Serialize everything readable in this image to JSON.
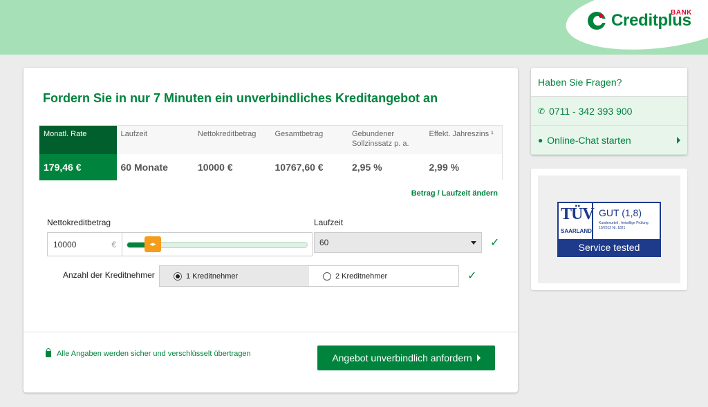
{
  "brand": {
    "name": "Creditplus",
    "tag": "BANK"
  },
  "headline": "Fordern Sie in nur 7 Minuten ein unverbindliches Kreditangebot an",
  "rate_table": [
    {
      "header": "Monatl. Rate",
      "value": "179,46 €"
    },
    {
      "header": "Laufzeit",
      "value": "60 Monate"
    },
    {
      "header": "Nettokreditbetrag",
      "value": "10000 €"
    },
    {
      "header": "Gesamtbetrag",
      "value": "10767,60 €"
    },
    {
      "header": "Gebundener Sollzinssatz p. a.",
      "value": "2,95 %"
    },
    {
      "header": "Effekt. Jahreszins ¹",
      "value": "2,99 %"
    }
  ],
  "change_link": "Betrag / Laufzeit ändern",
  "amount": {
    "label": "Nettokreditbetrag",
    "value": "10000",
    "currency": "€",
    "slider_fraction": 0.12
  },
  "term": {
    "label": "Laufzeit",
    "selected": "60"
  },
  "borrowers": {
    "label": "Anzahl der Kreditnehmer",
    "options": [
      "1 Kreditnehmer",
      "2 Kreditnehmer"
    ],
    "selected_index": 0
  },
  "secure_note": "Alle Angaben werden sicher und verschlüsselt übertragen",
  "cta_label": "Angebot unverbindlich anfordern",
  "help": {
    "title": "Haben Sie Fragen?",
    "phone": "0711 - 342 393 900",
    "chat": "Online-Chat starten"
  },
  "tuv": {
    "logo": "TÜV",
    "region": "SAARLAND",
    "grade": "GUT (1,8)",
    "small_line1": "Kundenurteil , freiwillige Prüfung",
    "small_line2": "10/2012  Nr. 1821",
    "service": "Service tested"
  },
  "colors": {
    "brand_green": "#00843d",
    "dark_green": "#005f2c",
    "header_bg": "#a5e0b6",
    "slider_handle": "#f59c1a",
    "tuv_blue": "#1e3a8a"
  },
  "icons": [
    "logo-mark-icon",
    "slider-handle-icon",
    "caret-down-icon",
    "check-icon",
    "lock-icon",
    "chevron-right-icon",
    "phone-icon",
    "chat-icon"
  ]
}
